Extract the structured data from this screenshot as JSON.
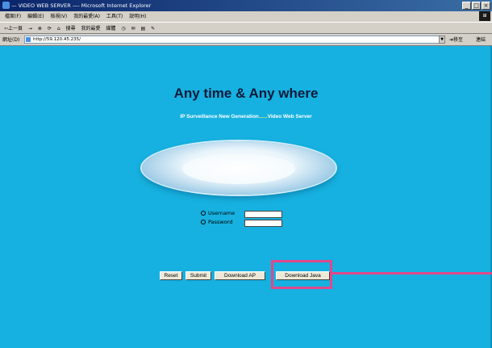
{
  "window": {
    "title": "— VIDEO WEB SERVER —- Microsoft Internet Explorer",
    "controls": [
      "_",
      "□",
      "×"
    ]
  },
  "menu": [
    "檔案(F)",
    "編輯(E)",
    "檢視(V)",
    "我的最愛(A)",
    "工具(T)",
    "說明(H)"
  ],
  "toolbar": [
    "⇦上一頁",
    "→",
    "⊗",
    "⟳",
    "⌂",
    "搜尋",
    "我的最愛",
    "媒體",
    "◷",
    "✉",
    "▤",
    "✎"
  ],
  "address": {
    "label": "網址(D)",
    "url": "http://59.120.45.235/",
    "go": "移至",
    "links": "連結"
  },
  "page": {
    "headline": "Any time & Any where",
    "subtitle_part1": "IP Surveillance New Generation",
    "subtitle_part2": "......",
    "subtitle_part3": "Video Web Server",
    "username_label": "Username",
    "password_label": "Password",
    "username_value": "",
    "password_value": "",
    "buttons": {
      "reset": "Reset",
      "submit": "Submit",
      "download_ap": "Download AP",
      "download_java": "Download Java"
    }
  },
  "colors": {
    "page_background": "#16b1e0",
    "highlight": "#e2478b"
  }
}
